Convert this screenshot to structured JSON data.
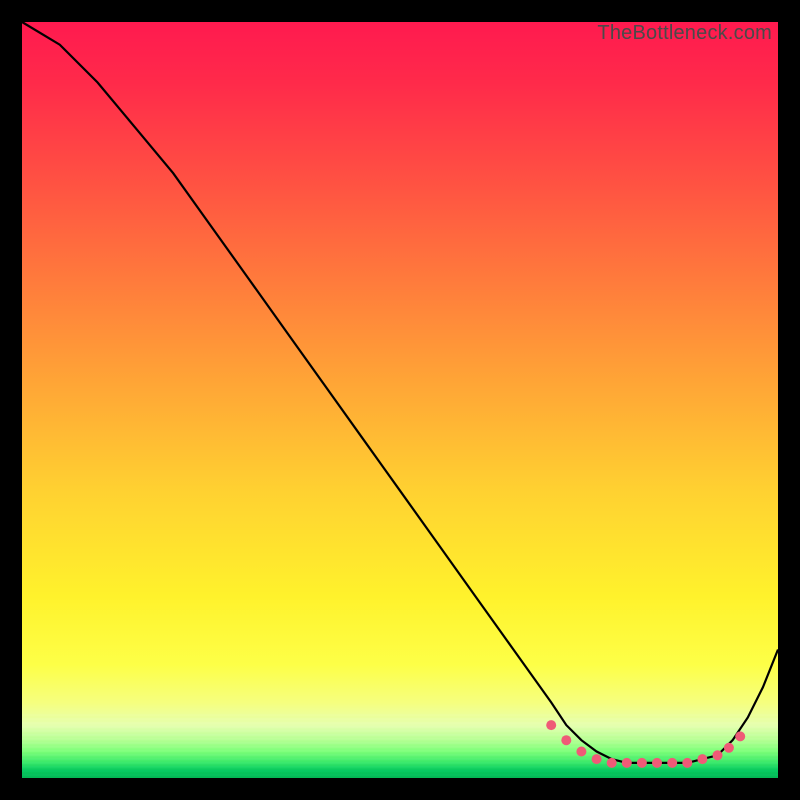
{
  "watermark": "TheBottleneck.com",
  "colors": {
    "frame_bg": "#000000",
    "curve": "#000000",
    "marker": "#ef5a77",
    "gradient_top": "#ff1a4f",
    "gradient_bottom": "#04b857"
  },
  "chart_data": {
    "type": "line",
    "title": "",
    "xlabel": "",
    "ylabel": "",
    "xlim": [
      0,
      100
    ],
    "ylim": [
      0,
      100
    ],
    "grid": false,
    "legend": false,
    "x": [
      0,
      5,
      10,
      15,
      20,
      25,
      30,
      35,
      40,
      45,
      50,
      55,
      60,
      65,
      70,
      72,
      74,
      76,
      78,
      80,
      82,
      84,
      86,
      88,
      90,
      92,
      94,
      96,
      98,
      100
    ],
    "y": [
      100,
      97,
      92,
      86,
      80,
      73,
      66,
      59,
      52,
      45,
      38,
      31,
      24,
      17,
      10,
      7,
      5,
      3.5,
      2.5,
      2,
      2,
      2,
      2,
      2,
      2.5,
      3,
      5,
      8,
      12,
      17
    ],
    "markers": {
      "comment": "pink dots along the trough and rising right segment",
      "x": [
        70,
        72,
        74,
        76,
        78,
        80,
        82,
        84,
        86,
        88,
        90,
        92,
        93.5,
        95
      ],
      "y": [
        7,
        5,
        3.5,
        2.5,
        2,
        2,
        2,
        2,
        2,
        2,
        2.5,
        3,
        4,
        5.5
      ]
    }
  }
}
